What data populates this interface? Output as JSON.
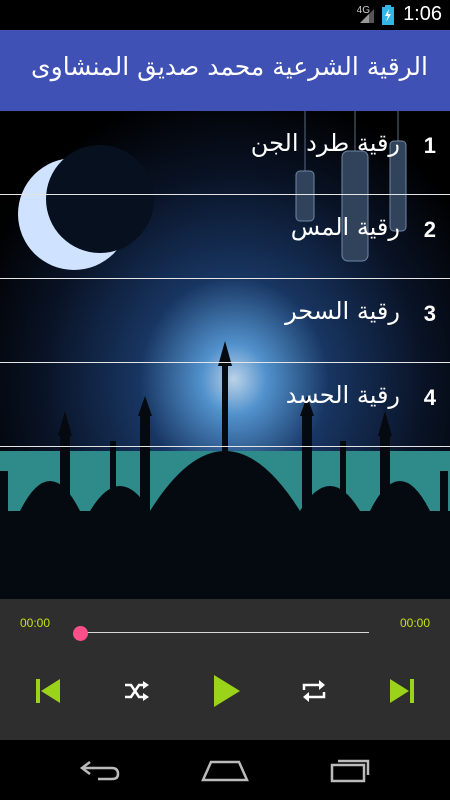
{
  "status": {
    "network": "4G",
    "time": "1:06"
  },
  "app": {
    "title": "الرقية الشرعية محمد صديق المنشاوى"
  },
  "tracks": [
    {
      "number": "1",
      "label": "رقية طرد الجن"
    },
    {
      "number": "2",
      "label": "رقية المس"
    },
    {
      "number": "3",
      "label": "رقية السحر"
    },
    {
      "number": "4",
      "label": "رقية الحسد"
    }
  ],
  "player": {
    "current_time": "00:00",
    "total_time": "00:00",
    "progress": 0
  },
  "colors": {
    "appbar": "#3f51b5",
    "accent": "#9bd31b",
    "seek_thumb": "#ff4f8b",
    "player_bg": "#2e2e2e"
  },
  "icons": {
    "controls": [
      "skip-previous-icon",
      "shuffle-icon",
      "play-icon",
      "repeat-icon",
      "skip-next-icon"
    ],
    "nav": [
      "back-icon",
      "home-icon",
      "recent-apps-icon"
    ]
  }
}
